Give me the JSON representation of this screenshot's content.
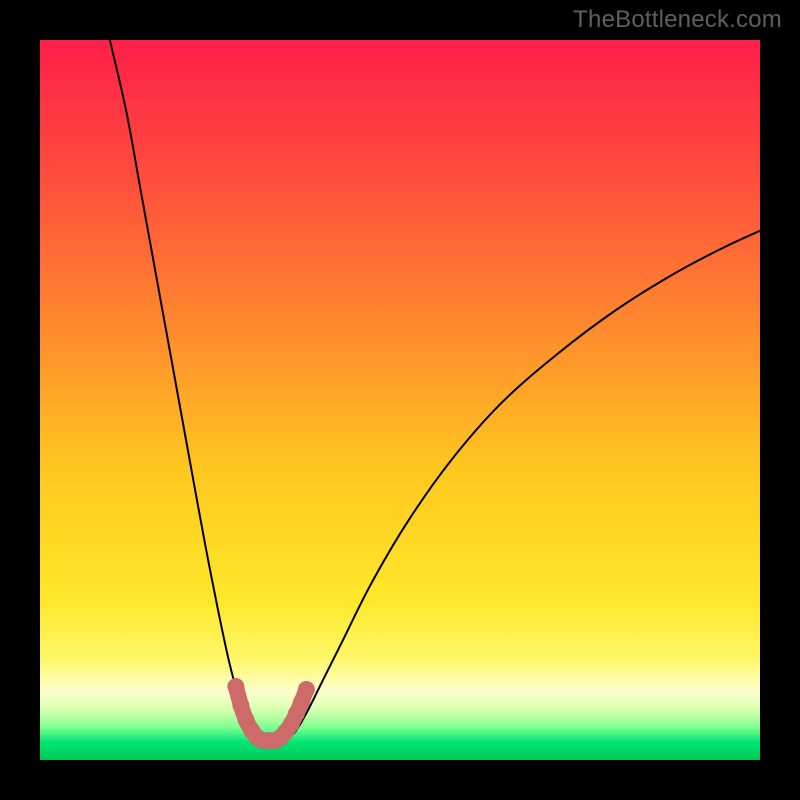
{
  "watermark": "TheBottleneck.com",
  "colors": {
    "black": "#000000",
    "curve": "#000000",
    "dots": "#cf6a6a",
    "gradient_stops": [
      {
        "offset": 0.0,
        "color": "#ff1f4a"
      },
      {
        "offset": 0.18,
        "color": "#ff4a3d"
      },
      {
        "offset": 0.4,
        "color": "#ff8a2e"
      },
      {
        "offset": 0.6,
        "color": "#ffc81f"
      },
      {
        "offset": 0.78,
        "color": "#ffe82a"
      },
      {
        "offset": 0.86,
        "color": "#fff76a"
      },
      {
        "offset": 0.905,
        "color": "#fdffce"
      },
      {
        "offset": 0.93,
        "color": "#d9ffb0"
      },
      {
        "offset": 0.955,
        "color": "#7dff8f"
      },
      {
        "offset": 0.975,
        "color": "#00e676"
      },
      {
        "offset": 1.0,
        "color": "#00c853"
      }
    ]
  },
  "chart_data": {
    "type": "line",
    "title": "",
    "xlabel": "",
    "ylabel": "",
    "xlim": [
      0,
      100
    ],
    "ylim": [
      0,
      100
    ],
    "grid": false,
    "legend": false,
    "series": [
      {
        "name": "left-branch",
        "x": [
          9.7,
          12,
          14,
          16,
          18,
          20,
          22,
          23.5,
          25,
          26.3,
          27.5,
          28.5,
          29.5,
          30.3
        ],
        "y": [
          100,
          90,
          79,
          68,
          57,
          46,
          35,
          27,
          19.5,
          13.5,
          9.0,
          5.8,
          3.8,
          2.8
        ]
      },
      {
        "name": "right-branch",
        "x": [
          34.2,
          35.5,
          37,
          39,
          42,
          46,
          51,
          57,
          64,
          72,
          80,
          88,
          95,
          100
        ],
        "y": [
          2.8,
          4.0,
          6.5,
          10.5,
          16.5,
          24.5,
          33,
          41.5,
          49.5,
          56.5,
          62.5,
          67.5,
          71.2,
          73.5
        ]
      },
      {
        "name": "trough-highlight",
        "x": [
          27.2,
          27.9,
          28.6,
          29.4,
          30.2,
          31.0,
          31.8,
          32.6,
          33.4,
          34.1,
          34.9,
          35.6,
          36.3,
          37.0
        ],
        "y": [
          10.2,
          7.6,
          5.6,
          4.1,
          3.1,
          2.7,
          2.7,
          2.7,
          3.1,
          3.9,
          5.0,
          6.4,
          8.0,
          9.8
        ]
      }
    ],
    "notes": "x and y are percentages of the plot area (0–100). Curve values are visually estimated from the image; no axis ticks or numeric labels are present in the source. The highlighted trough segment is drawn with thick rounded salmon dots."
  }
}
